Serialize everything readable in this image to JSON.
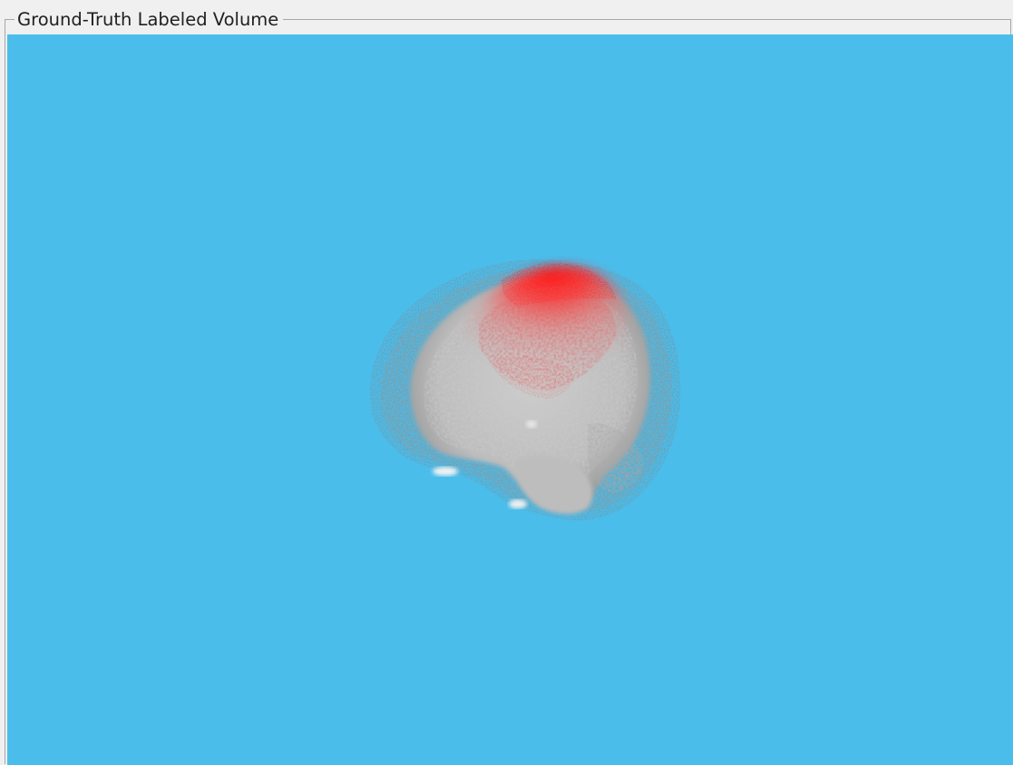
{
  "panel": {
    "title": "Ground-Truth Labeled Volume"
  },
  "colors": {
    "panel_background": "#f0f0f0",
    "viewport_background": "#4bbdeb",
    "volume_tissue": "#c4c4c4",
    "volume_label": "#ff1a1a"
  },
  "rendering": {
    "type": "3d-volume-render",
    "subject": "brain volume",
    "label_region": "top"
  }
}
